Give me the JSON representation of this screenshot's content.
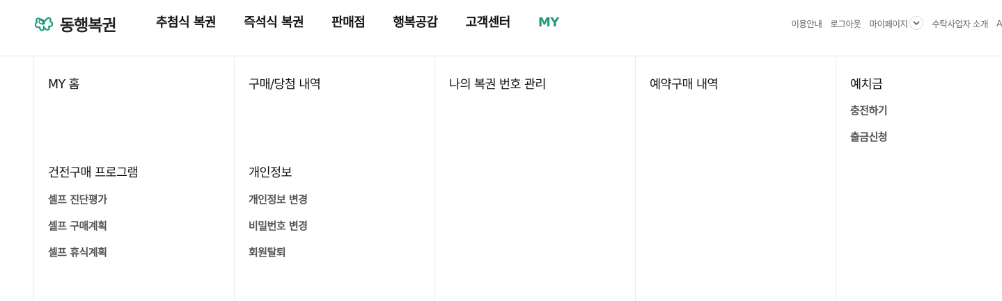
{
  "header": {
    "logo_text": "동행복권",
    "gnb": [
      "추첨식 복권",
      "즉석식 복권",
      "판매점",
      "행복공감",
      "고객센터",
      "MY"
    ],
    "active_color": "#1f9a7a",
    "util": {
      "guide": "이용안내",
      "logout": "로그아웃",
      "mypage": "마이페이지",
      "about": "수탁사업자 소개",
      "truncated": "A"
    }
  },
  "menu": {
    "col1": {
      "title1": "MY 홈",
      "title2": "건전구매 프로그램",
      "items": [
        "셀프 진단평가",
        "셀프 구매계획",
        "셀프 휴식계획"
      ]
    },
    "col2": {
      "title1": "구매/당첨 내역",
      "title2": "개인정보",
      "items": [
        "개인정보 변경",
        "비밀번호 변경",
        "회원탈퇴"
      ]
    },
    "col3": {
      "title1": "나의 복권 번호 관리"
    },
    "col4": {
      "title1": "예약구매 내역"
    },
    "col5": {
      "title1": "예치금",
      "items": [
        "충전하기",
        "출금신청"
      ]
    }
  }
}
